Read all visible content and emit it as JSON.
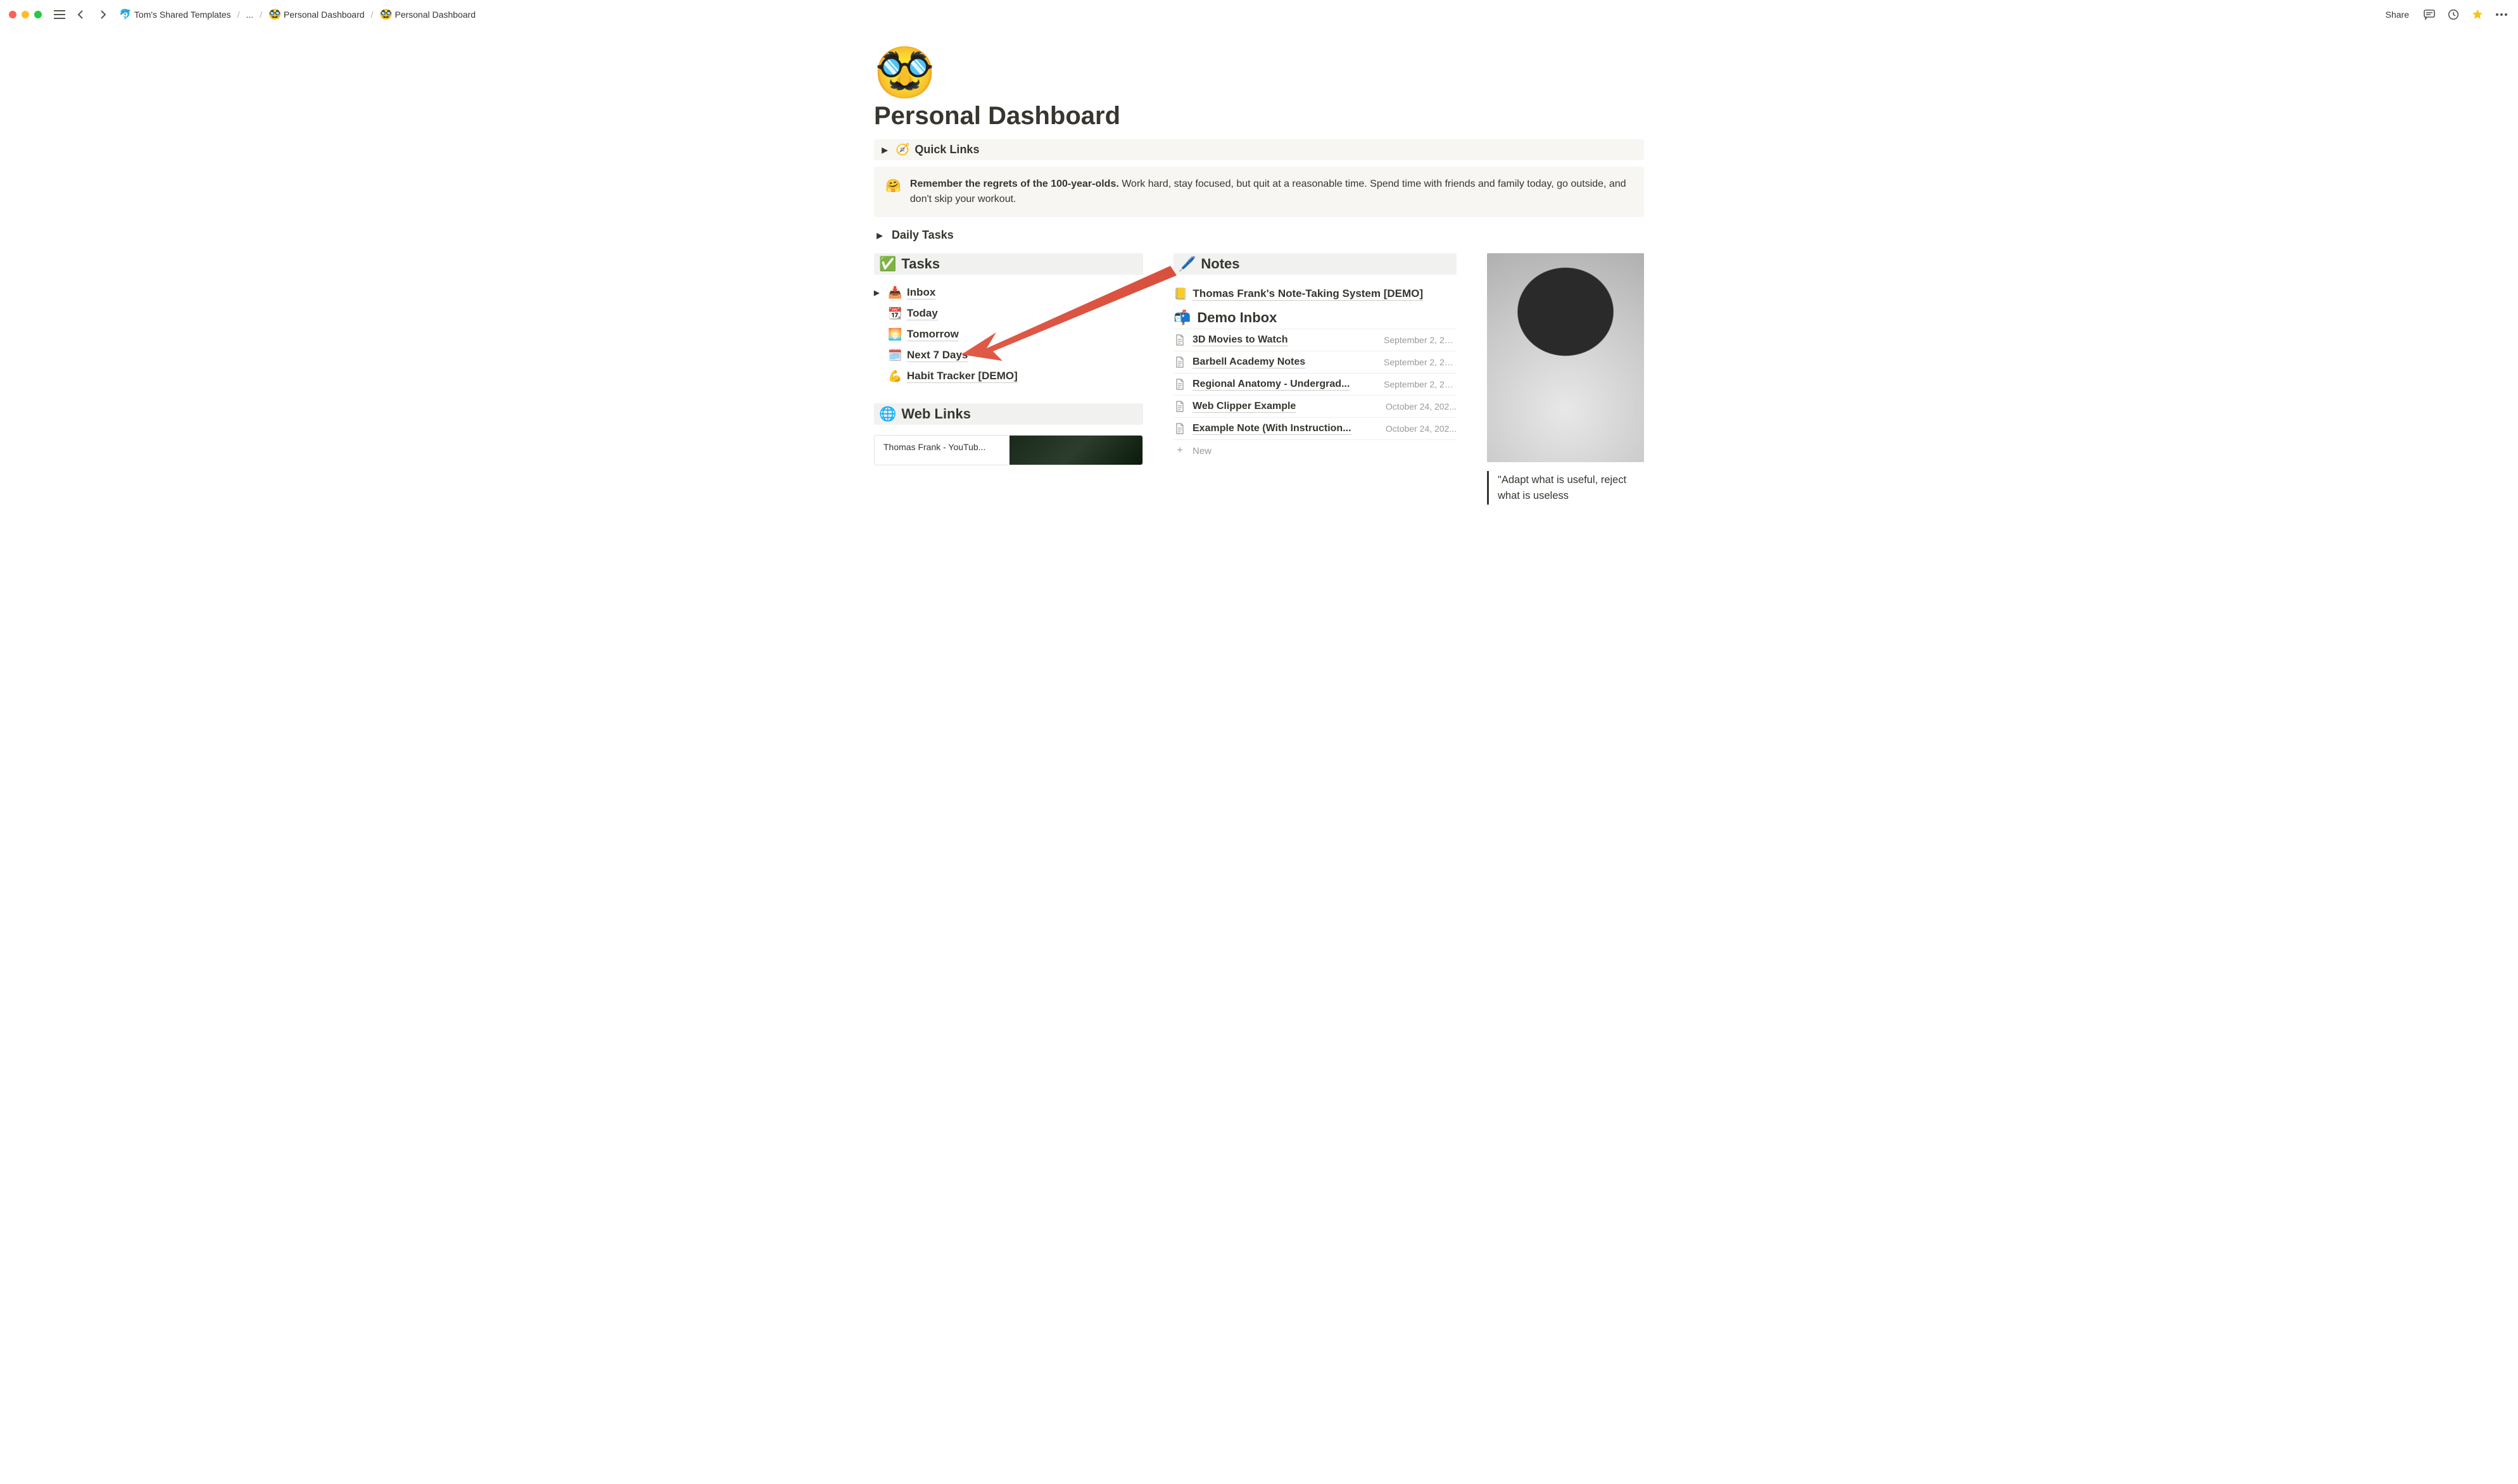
{
  "window": {
    "breadcrumbs": {
      "root_icon": "🐬",
      "root": "Tom's Shared Templates",
      "ellipsis": "...",
      "mid_icon": "🥸",
      "mid": "Personal Dashboard",
      "leaf_icon": "🥸",
      "leaf": "Personal Dashboard"
    },
    "share": "Share"
  },
  "page": {
    "emoji": "🥸",
    "title": "Personal Dashboard",
    "quick_links": {
      "icon": "🧭",
      "label": "Quick Links"
    },
    "callout": {
      "emoji": "🤗",
      "bold": "Remember the regrets of the 100-year-olds.",
      "rest": " Work hard, stay focused, but quit at a reasonable time. Spend time with friends and family today, go outside, and don't skip your workout."
    },
    "daily_tasks": "Daily Tasks"
  },
  "tasks": {
    "header_icon": "✅",
    "header": "Tasks",
    "items": [
      {
        "caret": true,
        "emoji": "📥",
        "label": "Inbox"
      },
      {
        "caret": false,
        "emoji": "📆",
        "label": "Today"
      },
      {
        "caret": false,
        "emoji": "🌅",
        "label": "Tomorrow"
      },
      {
        "caret": false,
        "emoji": "🗓️",
        "label": "Next 7 Days"
      },
      {
        "caret": false,
        "emoji": "💪",
        "label": "Habit Tracker [DEMO]"
      }
    ]
  },
  "weblinks": {
    "header_icon": "🌐",
    "header": "Web Links",
    "bookmark": "Thomas Frank - YouTub..."
  },
  "notes": {
    "header_icon": "🖊️",
    "header": "Notes",
    "system_link": {
      "emoji": "📒",
      "label": "Thomas Frank's Note-Taking System [DEMO]"
    },
    "demo_inbox": {
      "emoji": "📬",
      "label": "Demo Inbox"
    },
    "rows": [
      {
        "title": "3D Movies to Watch",
        "date": "September 2, 20..."
      },
      {
        "title": "Barbell Academy Notes",
        "date": "September 2, 20..."
      },
      {
        "title": "Regional Anatomy - Undergrad...",
        "date": "September 2, 20..."
      },
      {
        "title": "Web Clipper Example",
        "date": "October 24, 202..."
      },
      {
        "title": "Example Note (With Instruction...",
        "date": "October 24, 202..."
      }
    ],
    "new": "New"
  },
  "quote": {
    "text": "\"Adapt what is useful, reject what is useless"
  },
  "arrow": {
    "color": "#e05a47"
  }
}
